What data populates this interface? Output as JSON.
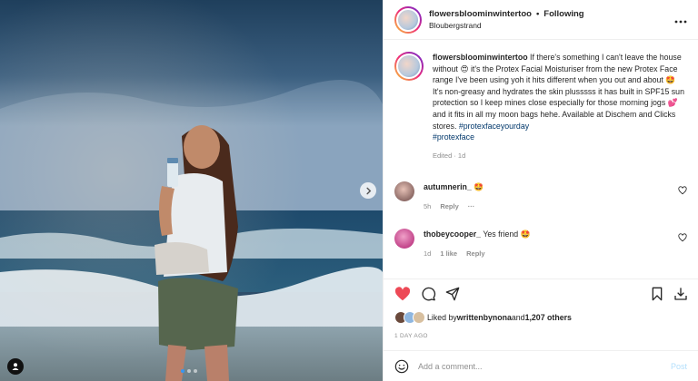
{
  "post": {
    "username": "flowersbloominwintertoo",
    "follow_separator": "•",
    "follow_label": "Following",
    "location": "Bloubergstrand",
    "more_icon": "more-horizontal-icon",
    "media": {
      "carousel_dots": 3,
      "active_dot": 0,
      "next_icon": "chevron-right-icon",
      "tag_icon": "user-tag-icon"
    },
    "caption": {
      "username": "flowersbloominwintertoo",
      "text_1": " If there's something I can't leave the house without ",
      "emoji_1": "😍",
      "text_2": " it's the Protex Facial Moisturiser from the new Protex Face range I've been using yoh it hits different when you out and about ",
      "emoji_2": "🤩",
      "text_3": " It's non-greasy and hydrates the skin plusssss it has built in SPF15 sun protection so I keep mines close especially for those morning jogs ",
      "emoji_3": "💕",
      "text_4": " and it fits in all my moon bags hehe. Available at Dischem and Clicks stores. ",
      "hashtag_1": "#protexfaceyourday",
      "hashtag_2": "#protexface",
      "meta": "Edited · 1d"
    },
    "comments": [
      {
        "username": "autumnerin_",
        "text": " 🤩",
        "time": "5h",
        "reply": "Reply",
        "more": "···"
      },
      {
        "username": "thobeycooper_",
        "text": " Yes friend 🤩",
        "time": "1d",
        "likes": "1 like",
        "reply": "Reply"
      }
    ],
    "actions": {
      "like_icon": "heart-filled-icon",
      "comment_icon": "comment-icon",
      "share_icon": "send-icon",
      "save_icon": "bookmark-icon",
      "download_icon": "download-icon"
    },
    "likes": {
      "prefix": "Liked by ",
      "user": "writtenbynona",
      "and": " and ",
      "others": "1,207 others"
    },
    "timestamp": "1 DAY AGO",
    "add_comment": {
      "placeholder": "Add a comment...",
      "post_label": "Post",
      "emoji_icon": "smiley-icon"
    }
  },
  "colors": {
    "like_red": "#ed4956",
    "link_blue": "#00376b",
    "post_disabled": "#b2dffc",
    "muted": "#8e8e8e"
  }
}
